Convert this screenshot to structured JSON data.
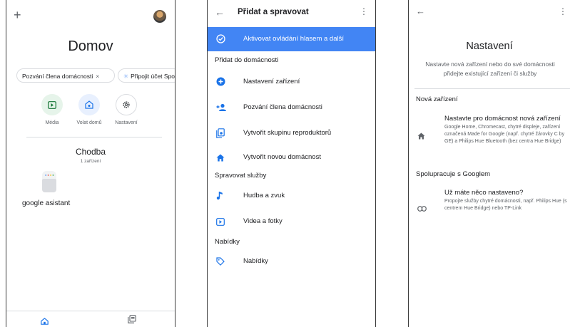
{
  "screen1": {
    "title": "Domov",
    "chips": [
      {
        "label": "Pozvání člena domácnosti",
        "close": "×"
      },
      {
        "label": "Připojit účet Spotify"
      }
    ],
    "actions": [
      {
        "label": "Média",
        "icon": "play-icon"
      },
      {
        "label": "Volat domů",
        "icon": "phone-home-icon"
      },
      {
        "label": "Nastavení",
        "icon": "gear-icon"
      }
    ],
    "room": {
      "name": "Chodba",
      "count": "1 zařízení"
    },
    "device": {
      "name": "google asistant"
    }
  },
  "screen2": {
    "title": "Přidat a spravovat",
    "highlight": "Aktivovat ovládání hlasem a další",
    "sections": {
      "add": "Přidat do domácnosti",
      "manage": "Spravovat služby",
      "offers": "Nabídky"
    },
    "add_items": [
      "Nastavení zařízení",
      "Pozvání člena domácnosti",
      "Vytvořit skupinu reproduktorů",
      "Vytvořit novou domácnost"
    ],
    "manage_items": [
      "Hudba a zvuk",
      "Videa a fotky"
    ],
    "offer_items": [
      "Nabídky"
    ]
  },
  "screen3": {
    "title": "Nastavení",
    "desc1": "Nastavte nová zařízení nebo do své domácnosti",
    "desc2": "přidejte existující zařízení či služby",
    "section_new": "Nová zařízení",
    "new_title": "Nastavte pro domácnost nová zařízení",
    "new_sub": "Google Home, Chromecast, chytré displeje, zařízení označená Made for Google (např. chytré žárovky C by GE) a Philips Hue Bluetooth (bez centra Hue Bridge)",
    "section_google": "Spolupracuje s Googlem",
    "google_title": "Už máte něco nastaveno?",
    "google_sub": "Propojte služby chytré domácnosti, např. Philips Hue (s centrem Hue Bridge) nebo TP-Link"
  },
  "colors": {
    "accent": "#4285f4",
    "green_bg": "#e6f4ea",
    "blue_bg": "#e8f0fe"
  }
}
